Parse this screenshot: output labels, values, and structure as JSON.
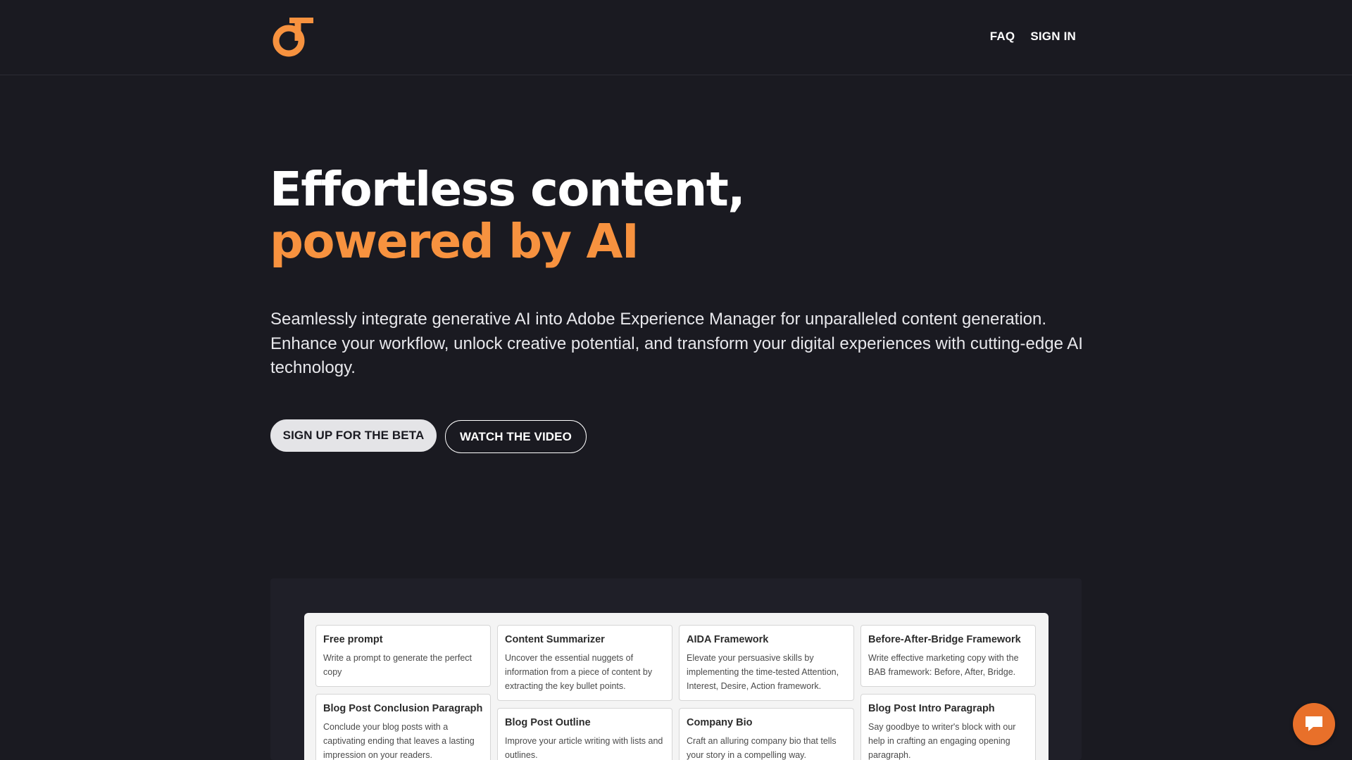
{
  "brand": {
    "logo_icon": "brand-logo-icon",
    "accent_color": "#f7923f"
  },
  "nav": {
    "items": [
      {
        "label": "FAQ"
      },
      {
        "label": "SIGN IN"
      }
    ]
  },
  "hero": {
    "title_line1": "Effortless content,",
    "title_line2": "powered by AI",
    "description": "Seamlessly integrate generative AI into Adobe Experience Manager for unparalleled content generation. Enhance your workflow, unlock creative potential, and transform your digital experiences with cutting-edge AI technology.",
    "primary_cta": "SIGN UP FOR THE BETA",
    "secondary_cta": "WATCH THE VIDEO"
  },
  "preview": {
    "cards": [
      {
        "title": "Free prompt",
        "description": "Write a prompt to generate the perfect copy"
      },
      {
        "title": "Content Summarizer",
        "description": "Uncover the essential nuggets of information from a piece of content by extracting the key bullet points."
      },
      {
        "title": "AIDA Framework",
        "description": "Elevate your persuasive skills by implementing the time-tested Attention, Interest, Desire, Action framework."
      },
      {
        "title": "Before-After-Bridge Framework",
        "description": "Write effective marketing copy with the BAB framework: Before, After, Bridge."
      },
      {
        "title": "Blog Post Conclusion Paragraph",
        "description": "Conclude your blog posts with a captivating ending that leaves a lasting impression on your readers."
      },
      {
        "title": "Blog Post Outline",
        "description": "Improve your article writing with lists and outlines."
      },
      {
        "title": "Company Bio",
        "description": "Craft an alluring company bio that tells your story in a compelling way."
      },
      {
        "title": "Blog Post Intro Paragraph",
        "description": "Say goodbye to writer's block with our help in crafting an engaging opening paragraph."
      }
    ]
  },
  "chat": {
    "icon": "chat-bubble-icon",
    "color": "#e8702a"
  }
}
